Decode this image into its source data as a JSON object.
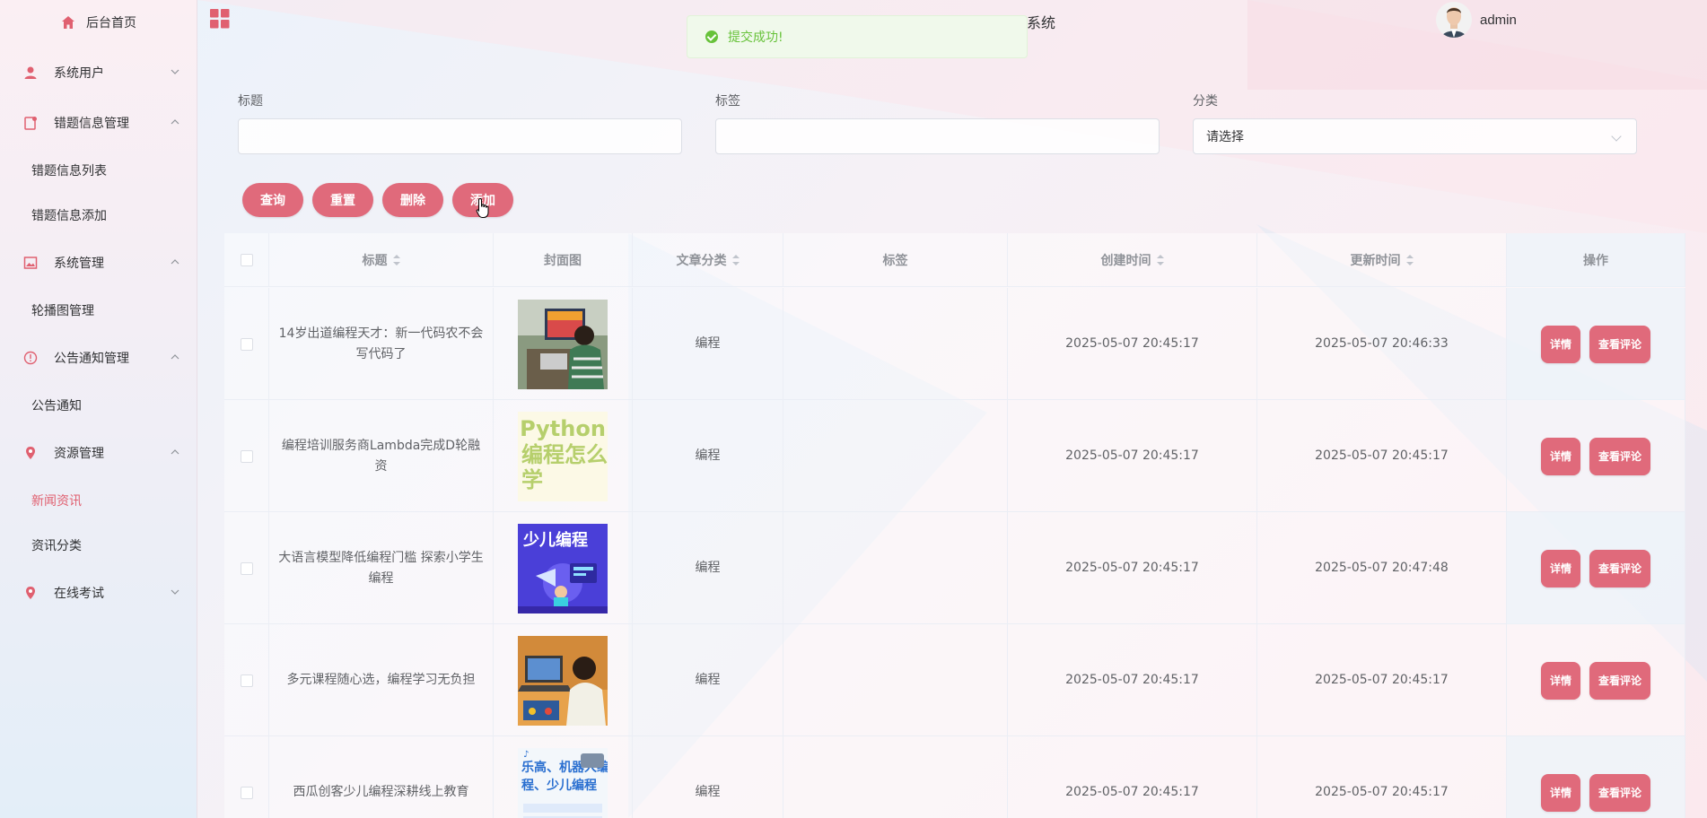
{
  "header": {
    "system_title": "张鸿等于人的编程知识刷题学习系统",
    "user_name": "admin"
  },
  "toast": {
    "message": "提交成功!",
    "type": "success"
  },
  "sidebar": {
    "home": "后台首页",
    "items": [
      {
        "label": "系统用户",
        "icon": "user-icon",
        "expanded": false
      },
      {
        "label": "错题信息管理",
        "icon": "document-icon",
        "expanded": true,
        "children": [
          "错题信息列表",
          "错题信息添加"
        ]
      },
      {
        "label": "系统管理",
        "icon": "image-icon",
        "expanded": true,
        "children": [
          "轮播图管理"
        ]
      },
      {
        "label": "公告通知管理",
        "icon": "info-icon",
        "expanded": true,
        "children": [
          "公告通知"
        ]
      },
      {
        "label": "资源管理",
        "icon": "location-icon",
        "expanded": true,
        "children": [
          "新闻资讯",
          "资讯分类"
        ]
      },
      {
        "label": "在线考试",
        "icon": "location-icon",
        "expanded": false
      }
    ],
    "active": "新闻资讯"
  },
  "filters": {
    "title_label": "标题",
    "title_value": "",
    "tag_label": "标签",
    "tag_value": "",
    "category_label": "分类",
    "category_placeholder": "请选择"
  },
  "buttons": {
    "query": "查询",
    "reset": "重置",
    "delete": "删除",
    "add": "添加"
  },
  "table": {
    "columns": [
      "标题",
      "封面图",
      "文章分类",
      "标签",
      "创建时间",
      "更新时间",
      "操作"
    ],
    "rows": [
      {
        "title": "14岁出道编程天才：新一代码农不会写代码了",
        "cover": "child-at-computer-photo",
        "category": "编程",
        "tag": "",
        "created": "2025-05-07 20:45:17",
        "updated": "2025-05-07 20:46:33"
      },
      {
        "title": "编程培训服务商Lambda完成D轮融资",
        "cover": "python-poster",
        "category": "编程",
        "tag": "",
        "created": "2025-05-07 20:45:17",
        "updated": "2025-05-07 20:45:17"
      },
      {
        "title": "大语言模型降低编程门槛 探索小学生编程",
        "cover": "kids-coding-poster",
        "category": "编程",
        "tag": "",
        "created": "2025-05-07 20:45:17",
        "updated": "2025-05-07 20:47:48"
      },
      {
        "title": "多元课程随心选，编程学习无负担",
        "cover": "girl-with-laptop-photo",
        "category": "编程",
        "tag": "",
        "created": "2025-05-07 20:45:17",
        "updated": "2025-05-07 20:45:17"
      },
      {
        "title": "西瓜创客少儿编程深耕线上教育",
        "cover": "robot-coding-poster",
        "category": "编程",
        "tag": "",
        "created": "2025-05-07 20:45:17",
        "updated": "2025-05-07 20:45:17"
      }
    ],
    "row_buttons": {
      "detail": "详情",
      "comments": "查看评论"
    },
    "cover_texts": {
      "python_line1": "Python",
      "python_line2": "编程怎么",
      "python_line3": "学",
      "kids_text": "少儿编程",
      "robot_line1": "乐高、机器人编",
      "robot_line2": "程、少儿编程"
    }
  },
  "colors": {
    "accent": "#e06a7b",
    "active_menu": "#e06070",
    "success": "#67c23a"
  }
}
